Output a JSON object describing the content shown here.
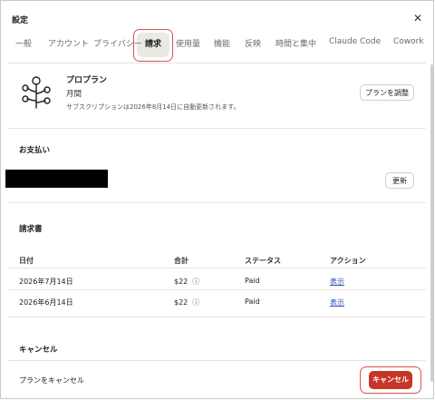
{
  "window": {
    "title": "設定"
  },
  "tabs": [
    {
      "label": "一般"
    },
    {
      "label": "アカウント"
    },
    {
      "label": "プライバシー"
    },
    {
      "label": "請求"
    },
    {
      "label": "使用量"
    },
    {
      "label": "機能"
    },
    {
      "label": "反映"
    },
    {
      "label": "時間と集中"
    },
    {
      "label": "Claude Code"
    },
    {
      "label": "Cowork"
    }
  ],
  "plan": {
    "name": "プロプラン",
    "period": "月間",
    "renewal": "サブスクリプションは2026年8月14日に自動更新されます。",
    "adjust_button": "プランを調整"
  },
  "payment": {
    "heading": "お支払い",
    "update_button": "更新"
  },
  "invoices": {
    "heading": "請求書",
    "columns": [
      "日付",
      "合計",
      "ステータス",
      "アクション"
    ],
    "rows": [
      {
        "date": "2026年7月14日",
        "total": "$22",
        "status": "Paid",
        "action": "表示"
      },
      {
        "date": "2026年6月14日",
        "total": "$22",
        "status": "Paid",
        "action": "表示"
      }
    ]
  },
  "cancel": {
    "heading": "キャンセル",
    "label": "プランをキャンセル",
    "button": "キャンセル"
  },
  "colors": {
    "danger": "#c63527",
    "highlight": "#d9534f",
    "link": "#2f4fbf"
  },
  "icons": {
    "close": "close-icon",
    "plan": "plan-tree-icon",
    "info": "info-icon"
  }
}
